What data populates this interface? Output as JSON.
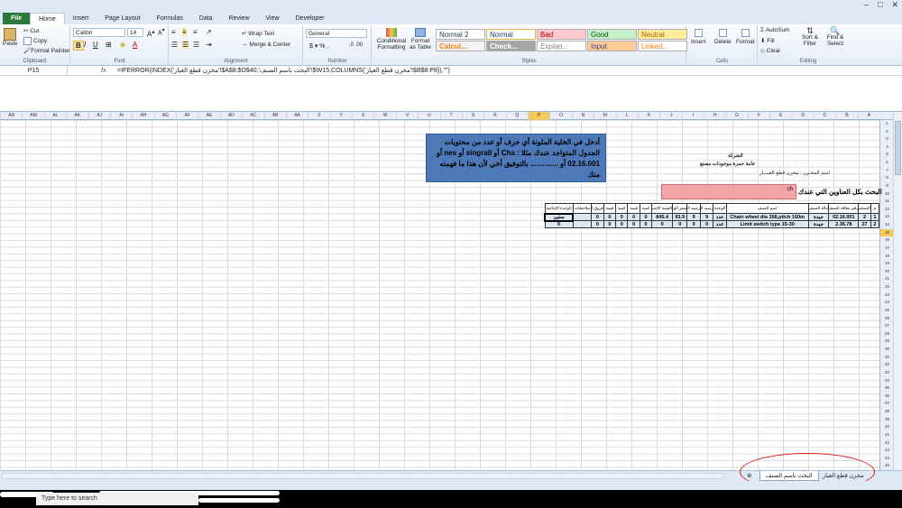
{
  "app": {
    "window_controls": [
      "–",
      "□",
      "✕"
    ]
  },
  "ribbon_tabs": [
    "File",
    "Home",
    "Insert",
    "Page Layout",
    "Formulas",
    "Data",
    "Review",
    "View",
    "Developer"
  ],
  "clipboard": {
    "paste": "Paste",
    "cut": "Cut",
    "copy": "Copy",
    "format_painter": "Format Painter",
    "label": "Clipboard"
  },
  "font": {
    "name": "Calibri",
    "size": "14",
    "label": "Font"
  },
  "alignment": {
    "wrap_text": "Wrap Text",
    "merge_center": "Merge & Center",
    "label": "Alignment"
  },
  "number": {
    "format": "General",
    "label": "Number"
  },
  "styles": {
    "conditional": "Conditional Formatting",
    "format_table": "Format as Table",
    "cells": [
      "Normal 2",
      "Normal",
      "Bad",
      "Good",
      "Neutral",
      "Calcul...",
      "Check...",
      "Explan...",
      "Input",
      "Linked..."
    ],
    "label": "Styles"
  },
  "cells_group": {
    "insert": "Insert",
    "delete": "Delete",
    "format": "Format",
    "label": "Cells"
  },
  "editing": {
    "autosum": "AutoSum",
    "fill": "Fill",
    "clear": "Clear",
    "sort": "Sort & Filter",
    "find": "Find & Select",
    "label": "Editing"
  },
  "formula_bar": {
    "cell_ref": "P15",
    "fx": "fx",
    "formula": "=IFERROR(INDEX('مخزن قطع الغيار'!$A$8:$O$40,'البحث باسم الصنف'!$W15,COLUMNS('مخزن قطع الغيار'!$B$8:P8)),\"\")"
  },
  "column_headers": [
    "AN",
    "AM",
    "AL",
    "AK",
    "AJ",
    "AI",
    "AH",
    "AG",
    "AF",
    "AE",
    "AD",
    "AC",
    "AB",
    "AA",
    "Z",
    "Y",
    "X",
    "W",
    "V",
    "U",
    "T",
    "S",
    "R",
    "Q",
    "P",
    "O",
    "N",
    "M",
    "L",
    "K",
    "J",
    "I",
    "H",
    "G",
    "F",
    "E",
    "D",
    "C",
    "B",
    "A"
  ],
  "row_count": 45,
  "note_box": "أدخل في الخلية الملونة أي حرف أو عدد من محتويات الجدول المتواجد عندك مثلا : Cha أو singrall أو nes أو 02.16.001 أو .............. بالتوفيق أخي لأن هذا ما فهمته منك",
  "sheet_text": {
    "company": "الشركة",
    "subtitle": "عامة حمرة موجودات مصنع",
    "store_label": "اسم المخـزن : مخزن قطع الغيـــار",
    "search_label": "البحث بكل العناوين التي عندك",
    "search_value": "ch"
  },
  "table": {
    "headers": [
      "م",
      "التسلسل",
      "رقم بطاقة الصنف",
      "حالة الصنف",
      "اسم الصنف",
      "الوحدة",
      "رصيد الجرد الدفتري",
      "رصيد الجرد الفعلي",
      "سعر الوحدة",
      "القيمة الإجمالية",
      "كمية",
      "قيمة",
      "كمية",
      "قيمة",
      "فروق الجرد",
      "ملاحظات",
      "الوحدة الإنتاجية"
    ],
    "rows": [
      [
        "1",
        "2",
        "02.16.001",
        "جيدة",
        "Chain wheel dia 368,pitch 160m",
        "عدد",
        "9",
        "9",
        "93.9",
        "845.4",
        "0",
        "0",
        "0",
        "0",
        "0",
        "",
        "ستين"
      ],
      [
        "2",
        "27",
        "2.36.78",
        "جيدة",
        "Limit switch type 15-30",
        "عدد",
        "0",
        "0",
        "0",
        "0",
        "0",
        "0",
        "0",
        "0",
        "0",
        "",
        "0"
      ]
    ]
  },
  "sheet_tabs": [
    "مخزن قطع الغيار",
    "البحث باسم الصنف"
  ],
  "taskbar": {
    "search_placeholder": "Type here to search"
  },
  "colors": {
    "accent": "#2a7a3b",
    "note_fill": "#4e79b9",
    "search_cell": "#f2a4a7",
    "annotation": "#e01b1b"
  }
}
